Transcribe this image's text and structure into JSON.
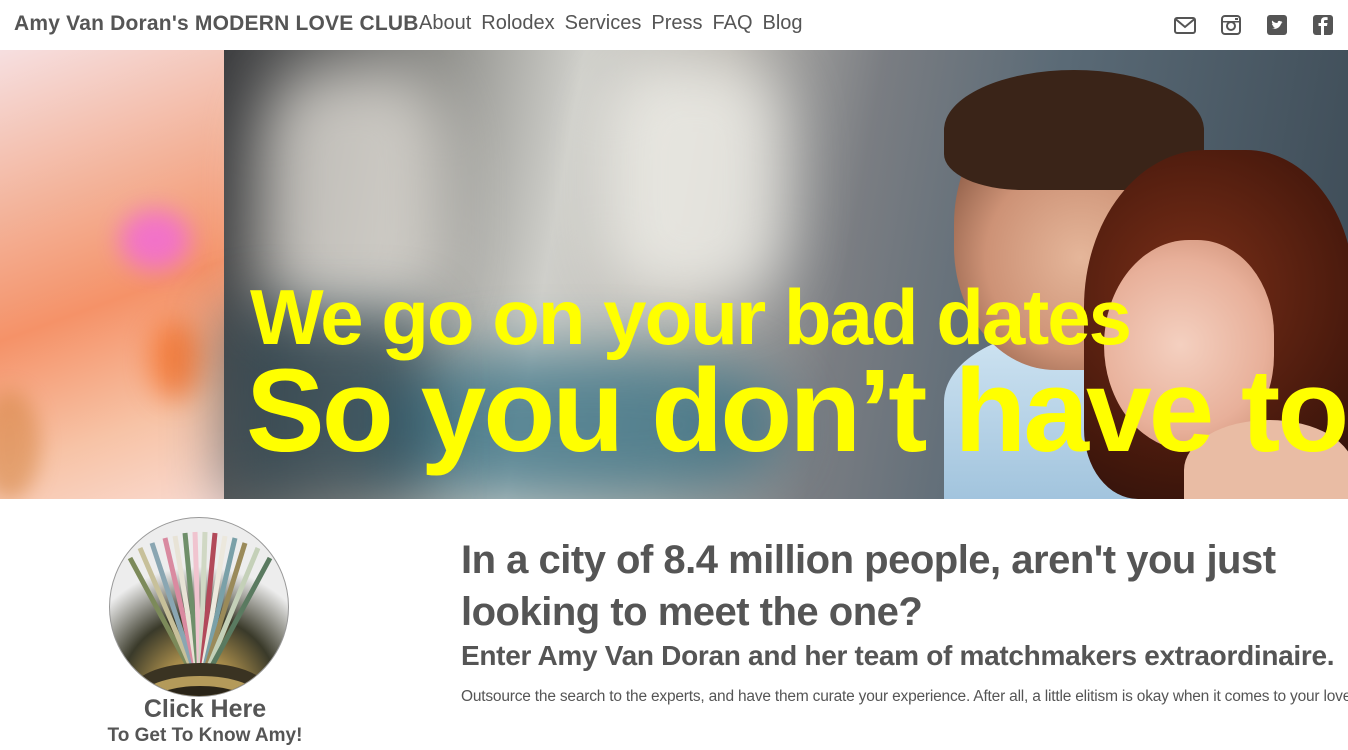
{
  "header": {
    "brand": "Amy Van Doran's MODERN LOVE CLUB",
    "nav": [
      "About",
      "Rolodex",
      "Services",
      "Press",
      "FAQ",
      "Blog"
    ],
    "social": [
      "mail-icon",
      "instagram-icon",
      "twitter-icon",
      "facebook-icon"
    ]
  },
  "hero": {
    "line1": "We go on your bad dates",
    "line2": "So you don’t have to.",
    "text_color": "#ffff00"
  },
  "profile": {
    "click_here": "Click Here",
    "get_to_know": "To Get To Know Amy!"
  },
  "intro": {
    "headline": "In a city of 8.4 million people, aren't you just looking to meet the one?",
    "subheadline": "Enter Amy Van Doran and her team of matchmakers extraordinaire.",
    "body": "Outsource the search to the experts, and have them curate your experience. After all, a little elitism is okay when it comes to your love life."
  },
  "colors": {
    "text": "#555555",
    "accent": "#ffff00"
  }
}
